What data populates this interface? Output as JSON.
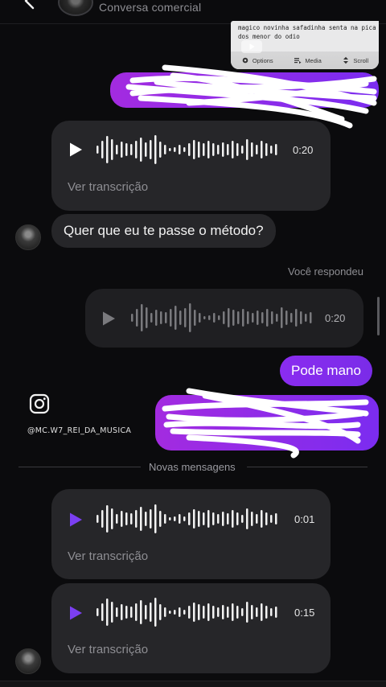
{
  "header": {
    "title": "Conversa comercial"
  },
  "shared_post": {
    "text": "magico novinha safadinha senta na pica dos menor do odio",
    "controls": [
      {
        "icon": "gear-icon",
        "label": "Options"
      },
      {
        "icon": "media-icon",
        "label": "Media"
      },
      {
        "icon": "scroll-icon",
        "label": "Scroll"
      }
    ]
  },
  "messages": {
    "voice1": {
      "duration": "0:20",
      "transcript_label": "Ver transcrição"
    },
    "text1": "Quer que eu te passe o método?",
    "reply_label": "Você respondeu",
    "voice_reply": {
      "duration": "0:20"
    },
    "out_text": "Pode mano",
    "voice2": {
      "duration": "0:01",
      "transcript_label": "Ver transcrição"
    },
    "voice3": {
      "duration": "0:15",
      "transcript_label": "Ver transcrição"
    }
  },
  "watermark": "@MC.W7_REI_DA_MUSICA",
  "divider_label": "Novas mensagens",
  "colors": {
    "background": "#0b0b0d",
    "bubble_incoming": "#262629",
    "bubble_outgoing": "#8a2cf0",
    "play_accent": "#7b3ff2",
    "muted_text": "#8e8e93"
  }
}
